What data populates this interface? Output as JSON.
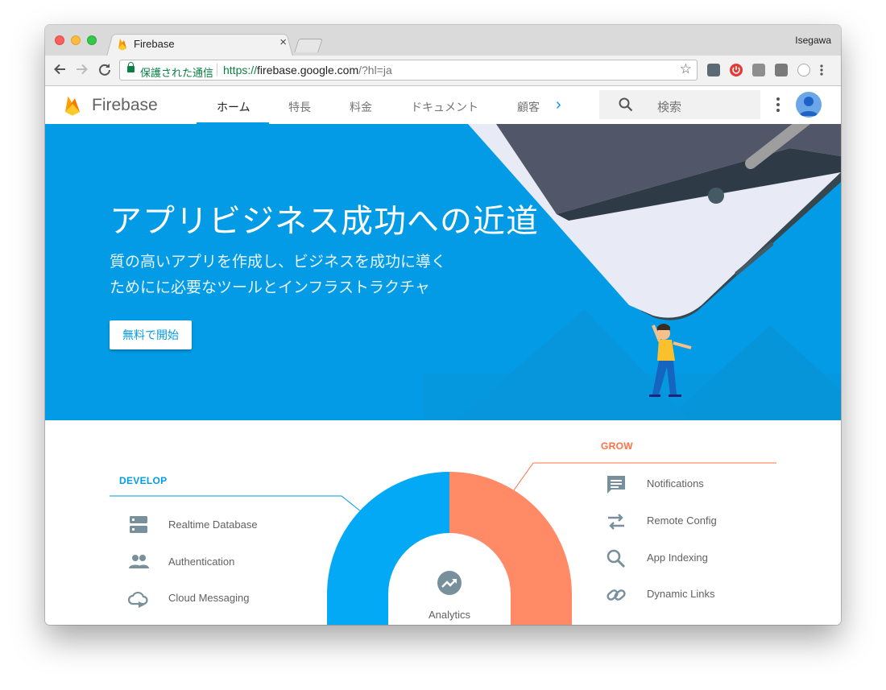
{
  "browser": {
    "tab_title": "Firebase",
    "tab_close": "×",
    "profile_name": "Isegawa",
    "secure_label": "保護された通信",
    "url_scheme": "https://",
    "url_host": "firebase.google.com",
    "url_path": "/?hl=ja"
  },
  "site": {
    "brand": "Firebase",
    "nav": [
      {
        "label": "ホーム",
        "active": true
      },
      {
        "label": "特長"
      },
      {
        "label": "料金"
      },
      {
        "label": "ドキュメント"
      },
      {
        "label": "顧客"
      }
    ],
    "nav_more": "›",
    "search_placeholder": "検索"
  },
  "hero": {
    "title": "アプリビジネス成功への近道",
    "subtitle_line1": "質の高いアプリを作成し、ビジネスを成功に導く",
    "subtitle_line2": "ためにに必要なツールとインフラストラクチャ",
    "cta": "無料で開始"
  },
  "features": {
    "develop_label": "DEVELOP",
    "grow_label": "GROW",
    "center_label": "Analytics",
    "develop": [
      {
        "label": "Realtime Database",
        "icon": "database-icon"
      },
      {
        "label": "Authentication",
        "icon": "people-icon"
      },
      {
        "label": "Cloud Messaging",
        "icon": "cloud-message-icon"
      }
    ],
    "grow": [
      {
        "label": "Notifications",
        "icon": "message-icon"
      },
      {
        "label": "Remote Config",
        "icon": "swap-arrows-icon"
      },
      {
        "label": "App Indexing",
        "icon": "search-icon"
      },
      {
        "label": "Dynamic Links",
        "icon": "link-icon"
      }
    ]
  },
  "colors": {
    "brand_blue": "#039be5",
    "grow_orange": "#ff8a65",
    "develop_blue": "#03a9f4"
  }
}
